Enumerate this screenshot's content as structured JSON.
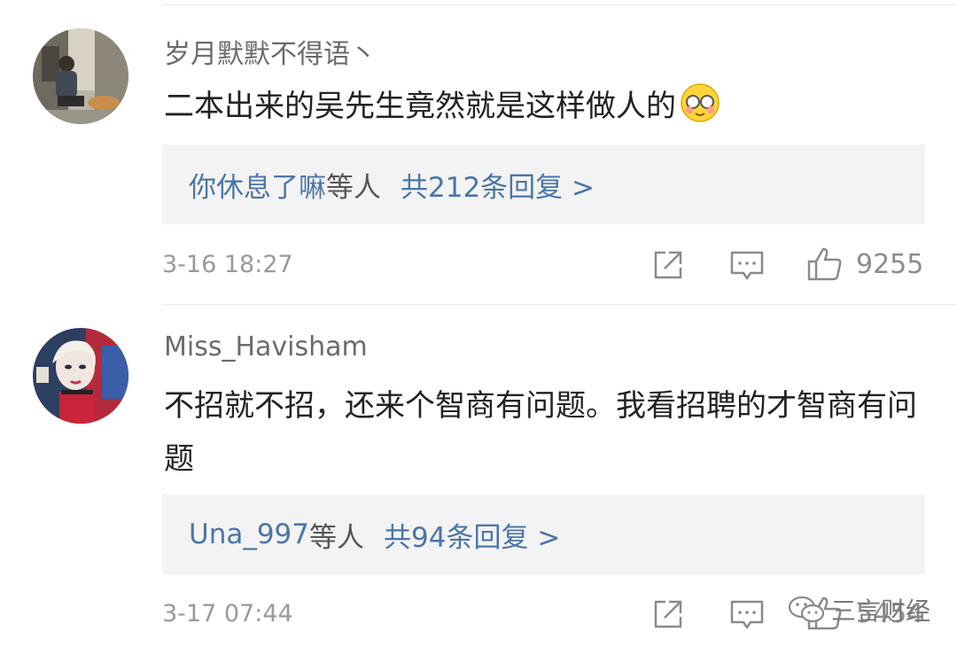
{
  "comments": [
    {
      "username": "岁月默默不得语丶",
      "text": "二本出来的吴先生竟然就是这样做人的",
      "emoji": "blushing-face-emoji",
      "reply_names": "你休息了嘛",
      "reply_suffix": "等人",
      "reply_count": "共212条回复 >",
      "time": "3-16 18:27",
      "likes": "9255"
    },
    {
      "username": "Miss_Havisham",
      "text": "不招就不招，还来个智商有问题。我看招聘的才智商有问题",
      "reply_names": "Una_997",
      "reply_suffix": "等人",
      "reply_count": "共94条回复 >",
      "time": "3-17 07:44",
      "likes": "5454"
    }
  ],
  "watermark": {
    "label": "三言财经",
    "icon": "wechat-icon"
  },
  "icons": {
    "share": "share-icon",
    "comment": "comment-icon",
    "like": "thumbs-up-icon"
  },
  "colors": {
    "link": "#4a76a8",
    "reply_bg": "#f3f3f3",
    "meta": "#9a9a9a"
  }
}
